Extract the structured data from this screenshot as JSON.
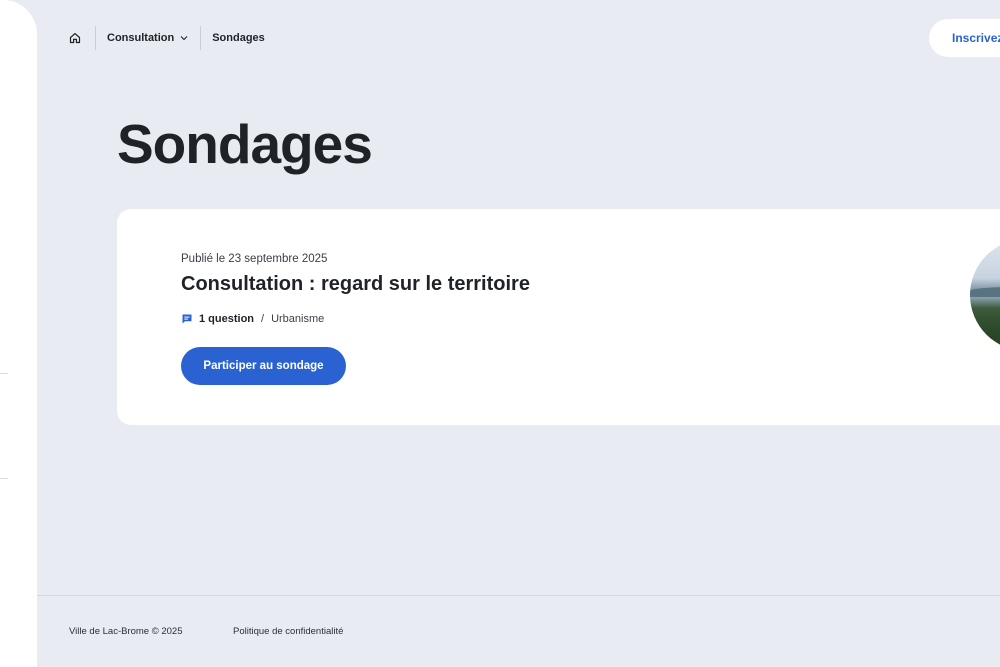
{
  "header": {
    "breadcrumb": {
      "home_icon": "home-icon",
      "items": [
        {
          "label": "Consultation",
          "icon": "chevron-down-icon"
        },
        {
          "label": "Sondages"
        }
      ]
    },
    "signup_label": "Inscrivez"
  },
  "main": {
    "title": "Sondages",
    "surveys": [
      {
        "published": "Publié le 23 septembre 2025",
        "title": "Consultation : regard sur le territoire",
        "question_icon": "chat-icon",
        "question_count": "1 question",
        "separator": "/",
        "category": "Urbanisme",
        "cta_label": "Participer au sondage",
        "image": "lake-landscape-photo"
      }
    ]
  },
  "footer": {
    "copyright": "Ville de Lac-Brome © 2025",
    "privacy_label": "Politique de confidentialité"
  },
  "colors": {
    "background": "#e8ebf1",
    "accent": "#2a63d1",
    "text": "#1f2328",
    "card": "#ffffff"
  }
}
